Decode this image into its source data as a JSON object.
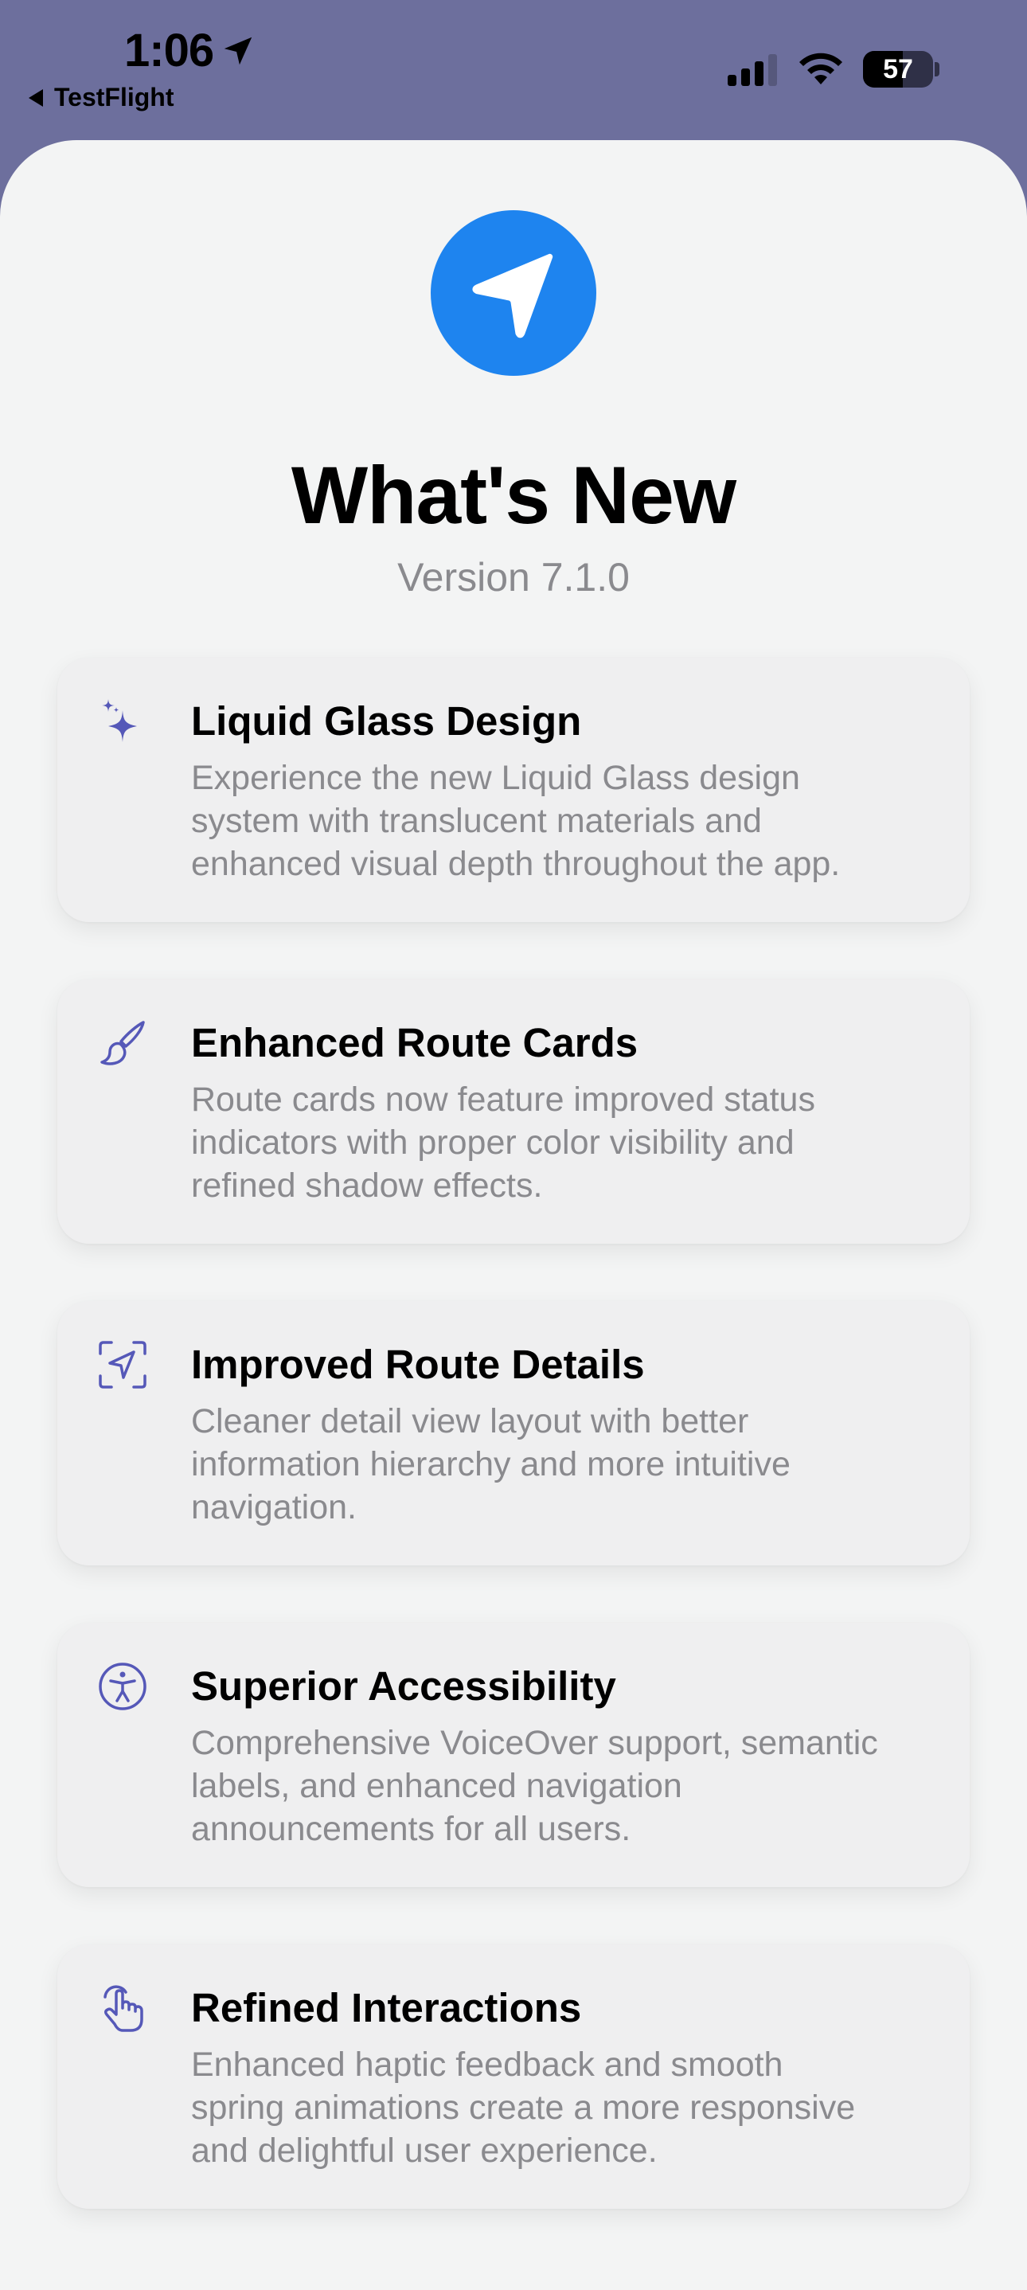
{
  "status_bar": {
    "time": "1:06",
    "back_label": "TestFlight",
    "battery_percent": "57",
    "battery_level": 0.57
  },
  "header": {
    "title": "What's New",
    "version": "Version 7.1.0"
  },
  "colors": {
    "accent": "#1e84ef",
    "icon_tint": "#5558b8",
    "sheet_background": "#f3f4f4",
    "backdrop": "#6d6f9d"
  },
  "features": [
    {
      "icon": "sparkles-icon",
      "title": "Liquid Glass Design",
      "description": "Experience the new Liquid Glass design\nsystem with translucent materials and\nenhanced visual depth throughout the app."
    },
    {
      "icon": "paintbrush-icon",
      "title": "Enhanced Route Cards",
      "description": "Route cards now feature improved status\nindicators with proper color visibility and\nrefined shadow effects."
    },
    {
      "icon": "location-viewfinder-icon",
      "title": "Improved Route Details",
      "description": "Cleaner detail view layout with better\ninformation hierarchy and more intuitive\nnavigation."
    },
    {
      "icon": "accessibility-icon",
      "title": "Superior Accessibility",
      "description": "Comprehensive VoiceOver support, semantic\nlabels, and enhanced navigation\nannouncements for all users."
    },
    {
      "icon": "hand-tap-icon",
      "title": "Refined Interactions",
      "description": "Enhanced haptic feedback and smooth\nspring animations create a more responsive\nand delightful user experience."
    }
  ]
}
